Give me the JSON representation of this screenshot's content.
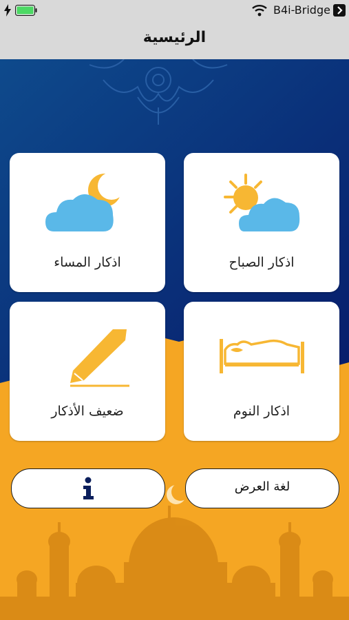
{
  "status_bar": {
    "carrier": "B4i-Bridge",
    "battery_color": "#4cd964"
  },
  "nav": {
    "title": "الرئيسية"
  },
  "cards": {
    "morning": {
      "label": "اذكار الصباح",
      "icon": "sun-cloud-icon"
    },
    "evening": {
      "label": "اذكار المساء",
      "icon": "moon-cloud-icon"
    },
    "sleep": {
      "label": "اذكار النوم",
      "icon": "bed-icon"
    },
    "weak": {
      "label": "ضعيف الأذكار",
      "icon": "pen-icon"
    }
  },
  "buttons": {
    "language": {
      "label": "لغة العرض"
    },
    "info": {
      "icon": "info-icon"
    }
  },
  "colors": {
    "navy": "#0b2a7a",
    "orange": "#f5a623",
    "cloud": "#5ab8e8",
    "accent": "#f7b733"
  }
}
